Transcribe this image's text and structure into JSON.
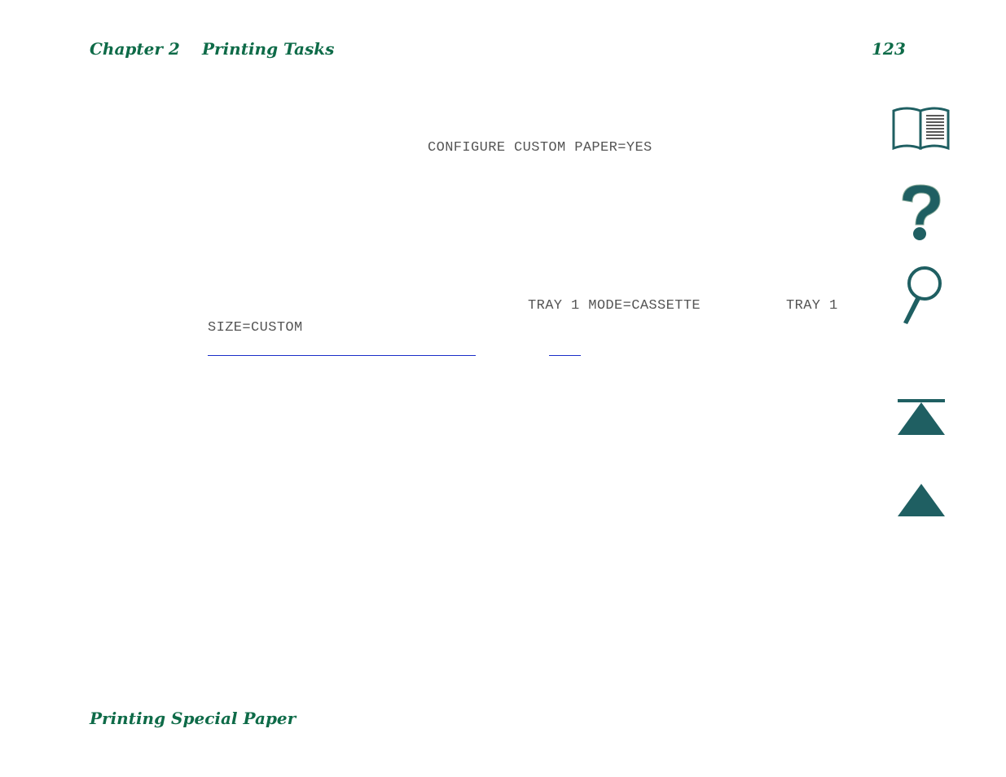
{
  "header": {
    "chapter": "Chapter 2",
    "section": "Printing Tasks",
    "page_number": "123"
  },
  "content": {
    "lcd_message_1": "CONFIGURE CUSTOM PAPER=YES",
    "lcd_message_2": "TRAY 1 MODE=CASSETTE",
    "lcd_message_3_part1": "TRAY 1",
    "lcd_message_3_part2": "SIZE=CUSTOM"
  },
  "footer": {
    "section_title": "Printing Special Paper"
  },
  "nav": {
    "icons": [
      "book-icon",
      "help-icon",
      "search-icon",
      "first-page-icon",
      "previous-page-icon"
    ],
    "accent_color": "#1f5f62"
  }
}
